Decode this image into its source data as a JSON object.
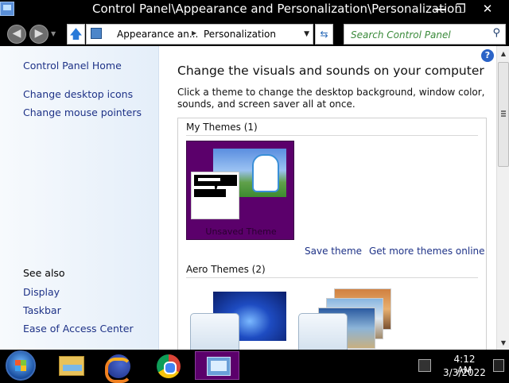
{
  "window": {
    "title": "Control Panel\\Appearance and Personalization\\Personalization",
    "minimize": "—",
    "maximize": "❐",
    "close": "✕"
  },
  "address_bar": {
    "crumb1": "Appearance an...",
    "crumb2": "Personalization",
    "separator": "▶",
    "dropdown": "▼",
    "refresh": "⇆",
    "up": "🡅",
    "search_placeholder": "Search Control Panel",
    "search_glyph": "⚲",
    "back_glyph": "◀",
    "forward_glyph": "▶",
    "history_glyph": "▼"
  },
  "sidebar": {
    "items": [
      {
        "label": "Control Panel Home"
      },
      {
        "label": "Change desktop icons"
      },
      {
        "label": "Change mouse pointers"
      }
    ],
    "see_also_label": "See also",
    "see_also": [
      {
        "label": "Display"
      },
      {
        "label": "Taskbar"
      },
      {
        "label": "Ease of Access Center"
      }
    ]
  },
  "main": {
    "help": "?",
    "heading": "Change the visuals and sounds on your computer",
    "description": "Click a theme to change the desktop background, window color, sounds, and screen saver all at once.",
    "my_themes_label": "My Themes (1)",
    "unsaved_theme_name": "Unsaved Theme",
    "save_theme": "Save theme",
    "get_more_themes": "Get more themes online",
    "aero_themes_label": "Aero Themes (2)"
  },
  "scrollbar": {
    "up": "▲",
    "down": "▼"
  },
  "taskbar": {
    "clock_time": "4:12 AM",
    "clock_date": "3/3/2022",
    "apps": [
      "windows-explorer",
      "firefox",
      "chrome",
      "control-panel"
    ]
  },
  "colors": {
    "link": "#1e3287",
    "theme_tile_bg": "#5b006b",
    "search_placeholder": "#3a8a3a"
  }
}
